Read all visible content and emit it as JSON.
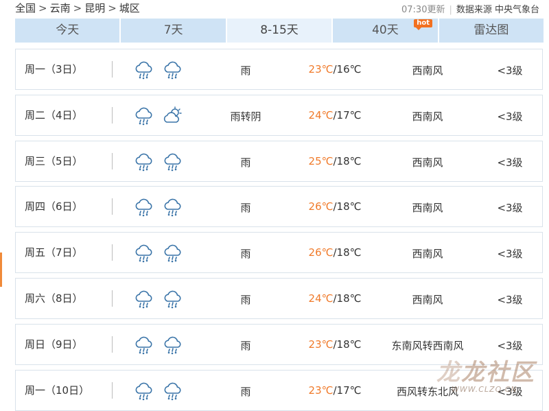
{
  "breadcrumb": [
    "全国",
    "云南",
    "昆明",
    "城区"
  ],
  "breadcrumb_sep": ">",
  "meta": {
    "update": "07:30更新",
    "source": "数据来源 中央气象台"
  },
  "tabs": [
    {
      "label": "今天"
    },
    {
      "label": "7天"
    },
    {
      "label": "8-15天",
      "active": true
    },
    {
      "label": "40天",
      "badge": "hot"
    },
    {
      "label": "雷达图"
    }
  ],
  "forecast": [
    {
      "day": "周一（3日）",
      "icons": [
        "rain-cloud-icon",
        "rain-cloud-icon"
      ],
      "desc": "雨",
      "high": "23℃",
      "low": "/16℃",
      "wind": "西南风",
      "level": "<3级"
    },
    {
      "day": "周二（4日）",
      "icons": [
        "rain-cloud-icon",
        "overcast-icon"
      ],
      "desc": "雨转阴",
      "high": "24℃",
      "low": "/17℃",
      "wind": "西南风",
      "level": "<3级"
    },
    {
      "day": "周三（5日）",
      "icons": [
        "rain-cloud-icon",
        "rain-cloud-icon"
      ],
      "desc": "雨",
      "high": "25℃",
      "low": "/18℃",
      "wind": "西南风",
      "level": "<3级"
    },
    {
      "day": "周四（6日）",
      "icons": [
        "rain-cloud-icon",
        "rain-cloud-icon"
      ],
      "desc": "雨",
      "high": "26℃",
      "low": "/18℃",
      "wind": "西南风",
      "level": "<3级"
    },
    {
      "day": "周五（7日）",
      "icons": [
        "rain-cloud-icon",
        "rain-cloud-icon"
      ],
      "desc": "雨",
      "high": "26℃",
      "low": "/18℃",
      "wind": "西南风",
      "level": "<3级"
    },
    {
      "day": "周六（8日）",
      "icons": [
        "rain-cloud-icon",
        "rain-cloud-icon"
      ],
      "desc": "雨",
      "high": "24℃",
      "low": "/18℃",
      "wind": "西南风",
      "level": "<3级"
    },
    {
      "day": "周日（9日）",
      "icons": [
        "rain-cloud-icon",
        "rain-cloud-icon"
      ],
      "desc": "雨",
      "high": "23℃",
      "low": "/18℃",
      "wind": "东南风转西南风",
      "level": "<3级"
    },
    {
      "day": "周一（10日）",
      "icons": [
        "rain-cloud-icon",
        "rain-cloud-icon"
      ],
      "desc": "雨",
      "high": "23℃",
      "low": "/17℃",
      "wind": "西风转东北风",
      "level": "<3级"
    }
  ],
  "watermark": {
    "text": "龙社区",
    "url": "WWW.CLZQ.CN"
  },
  "colors": {
    "tab_bg": "#cfe3f5",
    "tab_active_bg": "#e8f2fb",
    "high_temp": "#f07a2a",
    "icon_stroke": "#3a74a8",
    "hot_badge": "#f27020"
  }
}
